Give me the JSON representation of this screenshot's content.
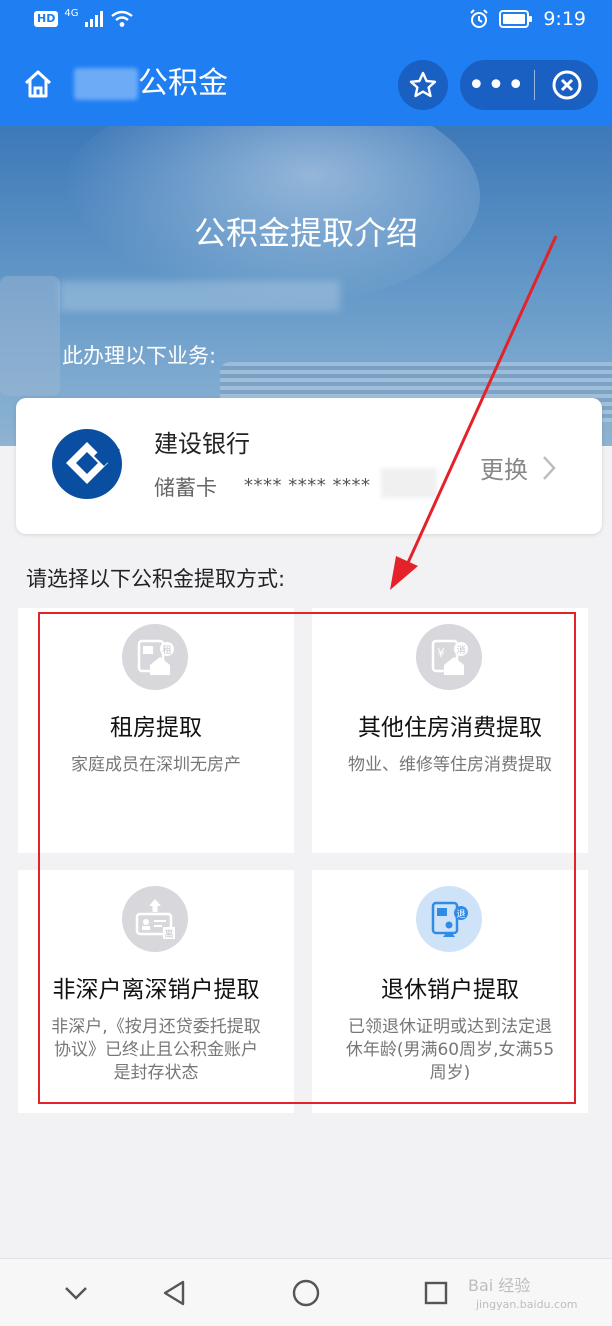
{
  "status_bar": {
    "hd": "HD",
    "network": "4G",
    "time": "9:19"
  },
  "header": {
    "title": "公积金",
    "more": "•••"
  },
  "banner": {
    "title": "公积金提取介绍",
    "subtitle": "此办理以下业务:"
  },
  "bank_card": {
    "bank_name": "建设银行",
    "card_type": "储蓄卡",
    "card_number": "**** **** ****",
    "change_label": "更换"
  },
  "section_label": "请选择以下公积金提取方式:",
  "options": [
    {
      "title": "租房提取",
      "desc": "家庭成员在深圳无房产",
      "icon": "rent-house-icon"
    },
    {
      "title": "其他住房消费提取",
      "desc": "物业、维修等住房消费提取",
      "icon": "housing-consumption-icon"
    },
    {
      "title": "非深户离深销户提取",
      "desc": "非深户,《按月还贷委托提取协议》已终止且公积金账户是封存状态",
      "icon": "account-closure-icon"
    },
    {
      "title": "退休销户提取",
      "desc": "已领退休证明或达到法定退休年龄(男满60周岁,女满55周岁)",
      "icon": "retirement-icon"
    }
  ],
  "watermark": {
    "brand": "Bai 经验",
    "url": "jingyan.baidu.com"
  },
  "colors": {
    "header_blue": "#1f7ef2",
    "annotation_red": "#e3222a"
  }
}
